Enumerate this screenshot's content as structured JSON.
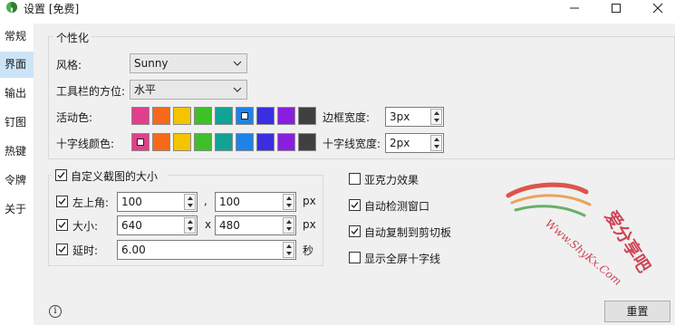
{
  "window": {
    "title": "设置 [免费]"
  },
  "sidebar": {
    "items": [
      {
        "label": "常规"
      },
      {
        "label": "界面"
      },
      {
        "label": "输出"
      },
      {
        "label": "钉图"
      },
      {
        "label": "热键"
      },
      {
        "label": "令牌"
      },
      {
        "label": "关于"
      }
    ],
    "active": "界面"
  },
  "personalization": {
    "group_title": "个性化",
    "style_label": "风格:",
    "style_value": "Sunny",
    "toolbar_pos_label": "工具栏的方位:",
    "toolbar_pos_value": "水平",
    "active_color_label": "活动色:",
    "crosshair_color_label": "十字线颜色:",
    "border_width_label": "边框宽度:",
    "border_width_value": "3px",
    "crosshair_width_label": "十字线宽度:",
    "crosshair_width_value": "2px",
    "palette": [
      "#e23f8a",
      "#f56a1a",
      "#f5c400",
      "#3fbf2a",
      "#12a394",
      "#1e82e8",
      "#3a2ee0",
      "#8a1ee0",
      "#404040"
    ],
    "active_color_selected": 5,
    "crosshair_color_selected": 0
  },
  "custom_size": {
    "group_title": "自定义截图的大小",
    "enabled": true,
    "top_left_label": "左上角:",
    "top_left_x": "100",
    "top_left_y": "100",
    "comma": ",",
    "size_label": "大小:",
    "width": "640",
    "height": "480",
    "times": "x",
    "delay_label": "延时:",
    "delay_value": "6.00",
    "px_unit": "px",
    "sec_unit": "秒"
  },
  "options": {
    "acrylic_label": "亚克力效果",
    "acrylic": false,
    "auto_detect_label": "自动检测窗口",
    "auto_detect": true,
    "auto_copy_label": "自动复制到剪切板",
    "auto_copy": true,
    "fullscreen_cross_label": "显示全屏十字线",
    "fullscreen_cross": false
  },
  "footer": {
    "info_glyph": "i",
    "reset_label": "重置"
  },
  "watermark": {
    "text_cn": "爱分享吧",
    "text_url": "Www.ShyKx.Com"
  }
}
